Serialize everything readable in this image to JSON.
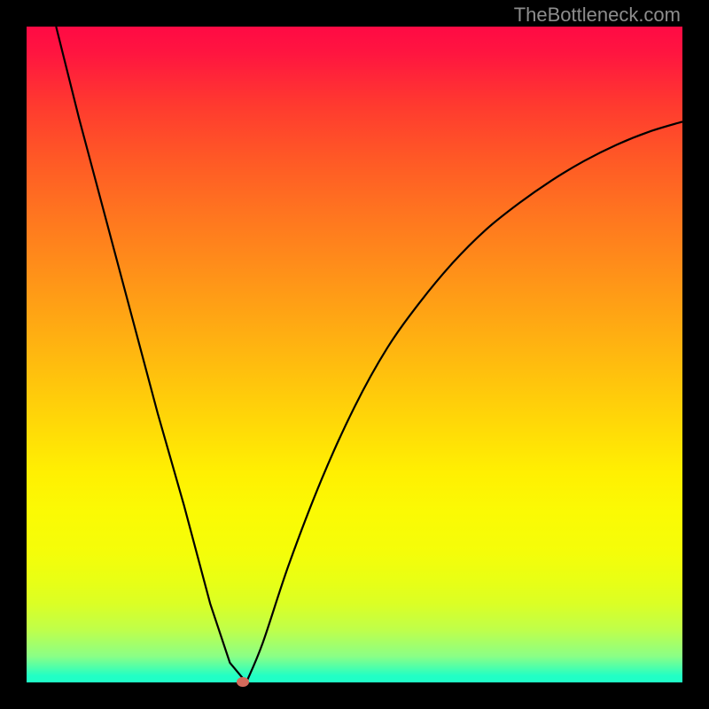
{
  "watermark": "TheBottleneck.com",
  "chart_data": {
    "type": "line",
    "title": "",
    "xlabel": "",
    "ylabel": "",
    "xlim": [
      0,
      100
    ],
    "ylim": [
      0,
      100
    ],
    "background_gradient": {
      "top": "#ff0a44",
      "bottom": "#20ffc7",
      "description": "vertical gradient red to green (heatmap style)"
    },
    "series": [
      {
        "name": "left-branch",
        "description": "steep descending line from top-left toward minimum",
        "x": [
          4.5,
          8,
          12,
          16,
          20,
          24,
          28,
          31,
          33.5
        ],
        "y": [
          100,
          86,
          71,
          56,
          41,
          27,
          12,
          3,
          0
        ]
      },
      {
        "name": "right-branch",
        "description": "ascending curve from minimum toward upper-right, flattening",
        "x": [
          33.5,
          36,
          40,
          45,
          50,
          55,
          60,
          65,
          70,
          75,
          80,
          85,
          90,
          95,
          100
        ],
        "y": [
          0,
          6,
          18,
          31,
          42,
          51,
          58,
          64,
          69,
          73,
          76.5,
          79.5,
          82,
          84,
          85.5
        ]
      }
    ],
    "marker": {
      "name": "minimum-dot",
      "x": 33,
      "y": 0,
      "color": "#d36a5b"
    }
  }
}
